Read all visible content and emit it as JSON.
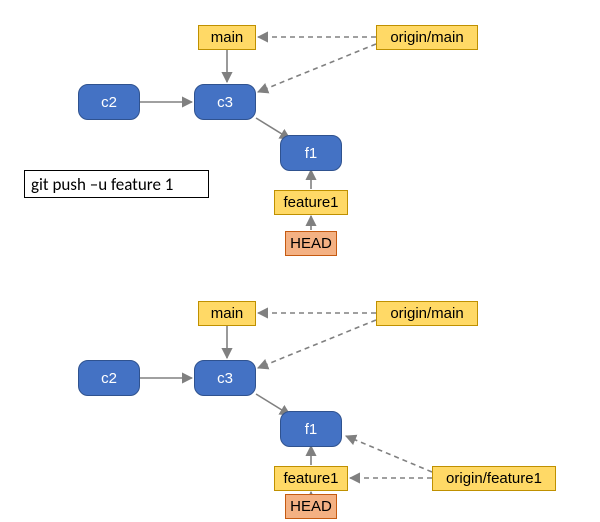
{
  "command_label": "git push –u feature 1",
  "before": {
    "commits": {
      "c2": "c2",
      "c3": "c3",
      "f1": "f1"
    },
    "branches": {
      "main": "main",
      "origin_main": "origin/main",
      "feature1": "feature1"
    },
    "head": "HEAD"
  },
  "after": {
    "commits": {
      "c2": "c2",
      "c3": "c3",
      "f1": "f1"
    },
    "branches": {
      "main": "main",
      "origin_main": "origin/main",
      "feature1": "feature1",
      "origin_feature1": "origin/feature1"
    },
    "head": "HEAD"
  },
  "colors": {
    "commit_fill": "#4472C4",
    "commit_border": "#2F528F",
    "branch_fill": "#FFD966",
    "branch_border": "#BF9000",
    "head_fill": "#F4B183",
    "head_border": "#C55A11",
    "arrow_solid": "#808080",
    "arrow_dashed": "#808080"
  }
}
